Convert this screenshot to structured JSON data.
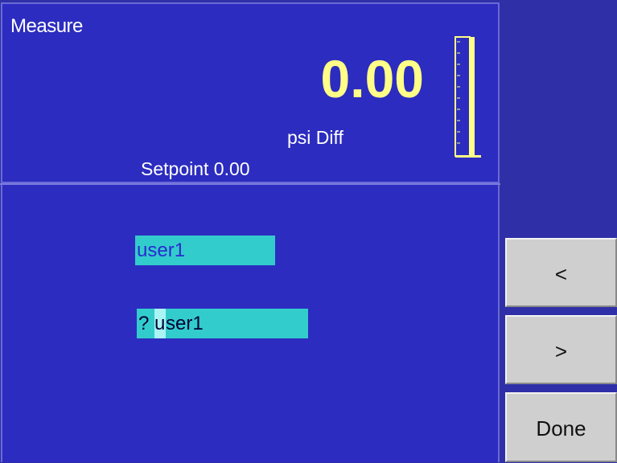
{
  "measure": {
    "title": "Measure",
    "reading": "0.00",
    "unit": "psi Diff",
    "setpoint": "Setpoint 0.00",
    "bar_level": 0
  },
  "entry": {
    "current_value": "user1",
    "prompt_prefix": "? ",
    "cursor_char": "u",
    "prompt_rest": "ser1"
  },
  "softkeys": {
    "prev_label": "<",
    "next_label": ">",
    "done_label": "Done"
  },
  "colors": {
    "panel": "#2c2cc0",
    "reading": "#ffff88",
    "field": "#33cccc",
    "key": "#cfcfcf"
  }
}
